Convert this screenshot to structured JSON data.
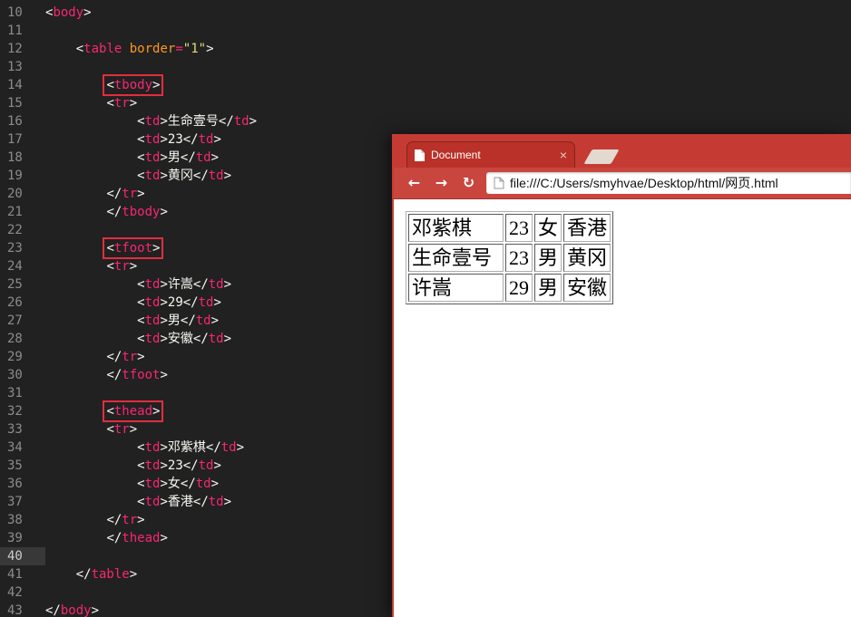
{
  "colors": {
    "editor-bg": "#212121",
    "code-fg": "#f8f8f2",
    "gutter-fg": "#8c8c8c",
    "tag-pink": "#f92672",
    "attr-orange": "#fd971f",
    "string-yellow": "#e6db74",
    "annotation-red": "#e12e3e",
    "chrome-red": "#c53b33",
    "tab-red": "#b93129",
    "toolbar-red": "#c8463e",
    "current-line": "#383838"
  },
  "editor": {
    "lines": [
      {
        "n": 10,
        "ind": 0,
        "tokens": [
          [
            "p",
            "<"
          ],
          [
            "tag",
            "body"
          ],
          [
            "p",
            ">"
          ]
        ]
      },
      {
        "n": 11,
        "ind": 0,
        "tokens": []
      },
      {
        "n": 12,
        "ind": 4,
        "tokens": [
          [
            "p",
            "<"
          ],
          [
            "tag",
            "table"
          ],
          [
            "p",
            " "
          ],
          [
            "attr",
            "border"
          ],
          [
            "op",
            "="
          ],
          [
            "str",
            "\"1\""
          ],
          [
            "p",
            ">"
          ]
        ]
      },
      {
        "n": 13,
        "ind": 0,
        "tokens": []
      },
      {
        "n": 14,
        "ind": 8,
        "boxed": true,
        "tokens": [
          [
            "p",
            "<"
          ],
          [
            "tag",
            "tbody"
          ],
          [
            "p",
            ">"
          ]
        ]
      },
      {
        "n": 15,
        "ind": 8,
        "tokens": [
          [
            "p",
            "<"
          ],
          [
            "tag",
            "tr"
          ],
          [
            "p",
            ">"
          ]
        ]
      },
      {
        "n": 16,
        "ind": 12,
        "tokens": [
          [
            "p",
            "<"
          ],
          [
            "tag",
            "td"
          ],
          [
            "p",
            ">"
          ],
          [
            "txt",
            "生命壹号"
          ],
          [
            "p",
            "</"
          ],
          [
            "tag",
            "td"
          ],
          [
            "p",
            ">"
          ]
        ]
      },
      {
        "n": 17,
        "ind": 12,
        "tokens": [
          [
            "p",
            "<"
          ],
          [
            "tag",
            "td"
          ],
          [
            "p",
            ">"
          ],
          [
            "txt",
            "23"
          ],
          [
            "p",
            "</"
          ],
          [
            "tag",
            "td"
          ],
          [
            "p",
            ">"
          ]
        ]
      },
      {
        "n": 18,
        "ind": 12,
        "tokens": [
          [
            "p",
            "<"
          ],
          [
            "tag",
            "td"
          ],
          [
            "p",
            ">"
          ],
          [
            "txt",
            "男"
          ],
          [
            "p",
            "</"
          ],
          [
            "tag",
            "td"
          ],
          [
            "p",
            ">"
          ]
        ]
      },
      {
        "n": 19,
        "ind": 12,
        "tokens": [
          [
            "p",
            "<"
          ],
          [
            "tag",
            "td"
          ],
          [
            "p",
            ">"
          ],
          [
            "txt",
            "黄冈"
          ],
          [
            "p",
            "</"
          ],
          [
            "tag",
            "td"
          ],
          [
            "p",
            ">"
          ]
        ]
      },
      {
        "n": 20,
        "ind": 8,
        "tokens": [
          [
            "p",
            "</"
          ],
          [
            "tag",
            "tr"
          ],
          [
            "p",
            ">"
          ]
        ]
      },
      {
        "n": 21,
        "ind": 8,
        "tokens": [
          [
            "p",
            "</"
          ],
          [
            "tag",
            "tbody"
          ],
          [
            "p",
            ">"
          ]
        ]
      },
      {
        "n": 22,
        "ind": 0,
        "tokens": []
      },
      {
        "n": 23,
        "ind": 8,
        "boxed": true,
        "tokens": [
          [
            "p",
            "<"
          ],
          [
            "tag",
            "tfoot"
          ],
          [
            "p",
            ">"
          ]
        ]
      },
      {
        "n": 24,
        "ind": 8,
        "tokens": [
          [
            "p",
            "<"
          ],
          [
            "tag",
            "tr"
          ],
          [
            "p",
            ">"
          ]
        ]
      },
      {
        "n": 25,
        "ind": 12,
        "tokens": [
          [
            "p",
            "<"
          ],
          [
            "tag",
            "td"
          ],
          [
            "p",
            ">"
          ],
          [
            "txt",
            "许嵩"
          ],
          [
            "p",
            "</"
          ],
          [
            "tag",
            "td"
          ],
          [
            "p",
            ">"
          ]
        ]
      },
      {
        "n": 26,
        "ind": 12,
        "tokens": [
          [
            "p",
            "<"
          ],
          [
            "tag",
            "td"
          ],
          [
            "p",
            ">"
          ],
          [
            "txt",
            "29"
          ],
          [
            "p",
            "</"
          ],
          [
            "tag",
            "td"
          ],
          [
            "p",
            ">"
          ]
        ]
      },
      {
        "n": 27,
        "ind": 12,
        "tokens": [
          [
            "p",
            "<"
          ],
          [
            "tag",
            "td"
          ],
          [
            "p",
            ">"
          ],
          [
            "txt",
            "男"
          ],
          [
            "p",
            "</"
          ],
          [
            "tag",
            "td"
          ],
          [
            "p",
            ">"
          ]
        ]
      },
      {
        "n": 28,
        "ind": 12,
        "tokens": [
          [
            "p",
            "<"
          ],
          [
            "tag",
            "td"
          ],
          [
            "p",
            ">"
          ],
          [
            "txt",
            "安徽"
          ],
          [
            "p",
            "</"
          ],
          [
            "tag",
            "td"
          ],
          [
            "p",
            ">"
          ]
        ]
      },
      {
        "n": 29,
        "ind": 8,
        "tokens": [
          [
            "p",
            "</"
          ],
          [
            "tag",
            "tr"
          ],
          [
            "p",
            ">"
          ]
        ]
      },
      {
        "n": 30,
        "ind": 8,
        "tokens": [
          [
            "p",
            "</"
          ],
          [
            "tag",
            "tfoot"
          ],
          [
            "p",
            ">"
          ]
        ]
      },
      {
        "n": 31,
        "ind": 0,
        "tokens": []
      },
      {
        "n": 32,
        "ind": 8,
        "boxed": true,
        "tokens": [
          [
            "p",
            "<"
          ],
          [
            "tag",
            "thead"
          ],
          [
            "p",
            ">"
          ]
        ]
      },
      {
        "n": 33,
        "ind": 8,
        "tokens": [
          [
            "p",
            "<"
          ],
          [
            "tag",
            "tr"
          ],
          [
            "p",
            ">"
          ]
        ]
      },
      {
        "n": 34,
        "ind": 12,
        "tokens": [
          [
            "p",
            "<"
          ],
          [
            "tag",
            "td"
          ],
          [
            "p",
            ">"
          ],
          [
            "txt",
            "邓紫棋"
          ],
          [
            "p",
            "</"
          ],
          [
            "tag",
            "td"
          ],
          [
            "p",
            ">"
          ]
        ]
      },
      {
        "n": 35,
        "ind": 12,
        "tokens": [
          [
            "p",
            "<"
          ],
          [
            "tag",
            "td"
          ],
          [
            "p",
            ">"
          ],
          [
            "txt",
            "23"
          ],
          [
            "p",
            "</"
          ],
          [
            "tag",
            "td"
          ],
          [
            "p",
            ">"
          ]
        ]
      },
      {
        "n": 36,
        "ind": 12,
        "tokens": [
          [
            "p",
            "<"
          ],
          [
            "tag",
            "td"
          ],
          [
            "p",
            ">"
          ],
          [
            "txt",
            "女"
          ],
          [
            "p",
            "</"
          ],
          [
            "tag",
            "td"
          ],
          [
            "p",
            ">"
          ]
        ]
      },
      {
        "n": 37,
        "ind": 12,
        "tokens": [
          [
            "p",
            "<"
          ],
          [
            "tag",
            "td"
          ],
          [
            "p",
            ">"
          ],
          [
            "txt",
            "香港"
          ],
          [
            "p",
            "</"
          ],
          [
            "tag",
            "td"
          ],
          [
            "p",
            ">"
          ]
        ]
      },
      {
        "n": 38,
        "ind": 8,
        "tokens": [
          [
            "p",
            "</"
          ],
          [
            "tag",
            "tr"
          ],
          [
            "p",
            ">"
          ]
        ]
      },
      {
        "n": 39,
        "ind": 8,
        "tokens": [
          [
            "p",
            "</"
          ],
          [
            "tag",
            "thead"
          ],
          [
            "p",
            ">"
          ]
        ]
      },
      {
        "n": 40,
        "ind": 0,
        "current": true,
        "tokens": []
      },
      {
        "n": 41,
        "ind": 4,
        "tokens": [
          [
            "p",
            "</"
          ],
          [
            "tag",
            "table"
          ],
          [
            "p",
            ">"
          ]
        ]
      },
      {
        "n": 42,
        "ind": 0,
        "tokens": []
      },
      {
        "n": 43,
        "ind": 0,
        "tokens": [
          [
            "p",
            "</"
          ],
          [
            "tag",
            "body"
          ],
          [
            "p",
            ">"
          ]
        ]
      }
    ]
  },
  "browser": {
    "tab": {
      "title": "Document",
      "close_glyph": "×"
    },
    "nav": {
      "back_glyph": "←",
      "forward_glyph": "→",
      "refresh_glyph": "↻"
    },
    "address": {
      "url": "file:///C:/Users/smyhvae/Desktop/html/网页.html"
    },
    "page": {
      "table_rows": [
        [
          "邓紫棋",
          "23",
          "女",
          "香港"
        ],
        [
          "生命壹号",
          "23",
          "男",
          "黄冈"
        ],
        [
          "许嵩",
          "29",
          "男",
          "安徽"
        ]
      ]
    }
  }
}
